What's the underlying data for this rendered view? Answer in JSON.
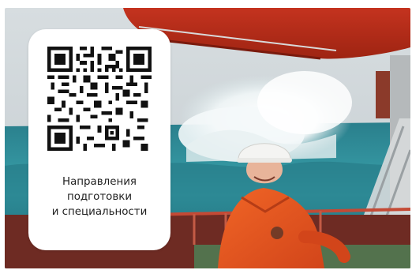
{
  "card": {
    "qr_icon": "qr-code-icon",
    "caption_lines": [
      "Направления",
      "подготовки",
      "и специальности"
    ]
  },
  "photo": {
    "subject": "sailor-in-orange-coverall-on-ship-deck",
    "scene": "stormy-sea-with-large-wave"
  },
  "colors": {
    "card_bg": "#ffffff",
    "caption_text": "#1f1f1f",
    "coverall_orange": "#e8521f",
    "sea_teal": "#2f8f9c"
  }
}
